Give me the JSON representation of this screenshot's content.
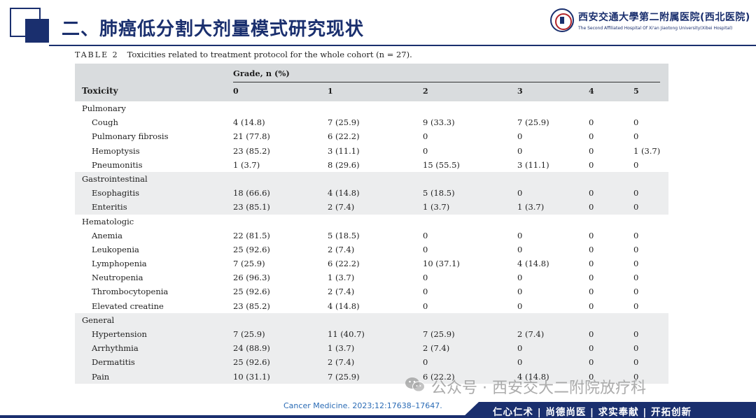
{
  "slide": {
    "title": "二、肺癌低分割大剂量模式研究现状",
    "logo_cn": "西安交通大學第二附属医院(西北医院)",
    "logo_en": "The Second Affiliated Hospital Of Xi'an Jiaotong University(Xibei Hospital)"
  },
  "caption": {
    "label": "TABLE 2",
    "text": "Toxicities related to treatment protocol for the whole cohort (n = 27)."
  },
  "table": {
    "grade_header": "Grade, n (%)",
    "toxicity_header": "Toxicity",
    "grades": [
      "0",
      "1",
      "2",
      "3",
      "4",
      "5"
    ],
    "sections": [
      {
        "name": "Pulmonary",
        "shaded": false,
        "rows": [
          {
            "name": "Cough",
            "values": [
              "4 (14.8)",
              "7 (25.9)",
              "9 (33.3)",
              "7 (25.9)",
              "0",
              "0"
            ]
          },
          {
            "name": "Pulmonary fibrosis",
            "values": [
              "21 (77.8)",
              "6 (22.2)",
              "0",
              "0",
              "0",
              "0"
            ]
          },
          {
            "name": "Hemoptysis",
            "values": [
              "23 (85.2)",
              "3 (11.1)",
              "0",
              "0",
              "0",
              "1 (3.7)"
            ]
          },
          {
            "name": "Pneumonitis",
            "values": [
              "1 (3.7)",
              "8 (29.6)",
              "15 (55.5)",
              "3 (11.1)",
              "0",
              "0"
            ]
          }
        ]
      },
      {
        "name": "Gastrointestinal",
        "shaded": true,
        "rows": [
          {
            "name": "Esophagitis",
            "values": [
              "18 (66.6)",
              "4 (14.8)",
              "5 (18.5)",
              "0",
              "0",
              "0"
            ]
          },
          {
            "name": "Enteritis",
            "values": [
              "23 (85.1)",
              "2 (7.4)",
              "1 (3.7)",
              "1 (3.7)",
              "0",
              "0"
            ]
          }
        ]
      },
      {
        "name": "Hematologic",
        "shaded": false,
        "rows": [
          {
            "name": "Anemia",
            "values": [
              "22 (81.5)",
              "5 (18.5)",
              "0",
              "0",
              "0",
              "0"
            ]
          },
          {
            "name": "Leukopenia",
            "values": [
              "25 (92.6)",
              "2 (7.4)",
              "0",
              "0",
              "0",
              "0"
            ]
          },
          {
            "name": "Lymphopenia",
            "values": [
              "7 (25.9)",
              "6 (22.2)",
              "10 (37.1)",
              "4 (14.8)",
              "0",
              "0"
            ]
          },
          {
            "name": "Neutropenia",
            "values": [
              "26 (96.3)",
              "1 (3.7)",
              "0",
              "0",
              "0",
              "0"
            ]
          },
          {
            "name": "Thrombocytopenia",
            "values": [
              "25 (92.6)",
              "2 (7.4)",
              "0",
              "0",
              "0",
              "0"
            ]
          },
          {
            "name": "Elevated creatine",
            "values": [
              "23 (85.2)",
              "4 (14.8)",
              "0",
              "0",
              "0",
              "0"
            ]
          }
        ]
      },
      {
        "name": "General",
        "shaded": true,
        "rows": [
          {
            "name": "Hypertension",
            "values": [
              "7 (25.9)",
              "11 (40.7)",
              "7 (25.9)",
              "2 (7.4)",
              "0",
              "0"
            ]
          },
          {
            "name": "Arrhythmia",
            "values": [
              "24 (88.9)",
              "1 (3.7)",
              "2 (7.4)",
              "0",
              "0",
              "0"
            ]
          },
          {
            "name": "Dermatitis",
            "values": [
              "25 (92.6)",
              "2 (7.4)",
              "0",
              "0",
              "0",
              "0"
            ]
          },
          {
            "name": "Pain",
            "values": [
              "10 (31.1)",
              "7 (25.9)",
              "6 (22.2)",
              "4 (14.8)",
              "0",
              "0"
            ]
          }
        ]
      }
    ]
  },
  "watermark": "公众号 · 西安交大二附院放疗科",
  "citation": "Cancer Medicine. 2023;12:17638–17647.",
  "footer_motto": "仁心仁术 | 尚德尚医 | 求实奉献 | 开拓创新",
  "colors": {
    "brand_navy": "#1a2f6e",
    "header_gray": "#d9dcde",
    "shade_gray": "#ecedee",
    "citation_blue": "#2a6bb5",
    "seal_red": "#b2242a"
  },
  "icons": [
    "wechat-icon",
    "university-seal-icon"
  ]
}
